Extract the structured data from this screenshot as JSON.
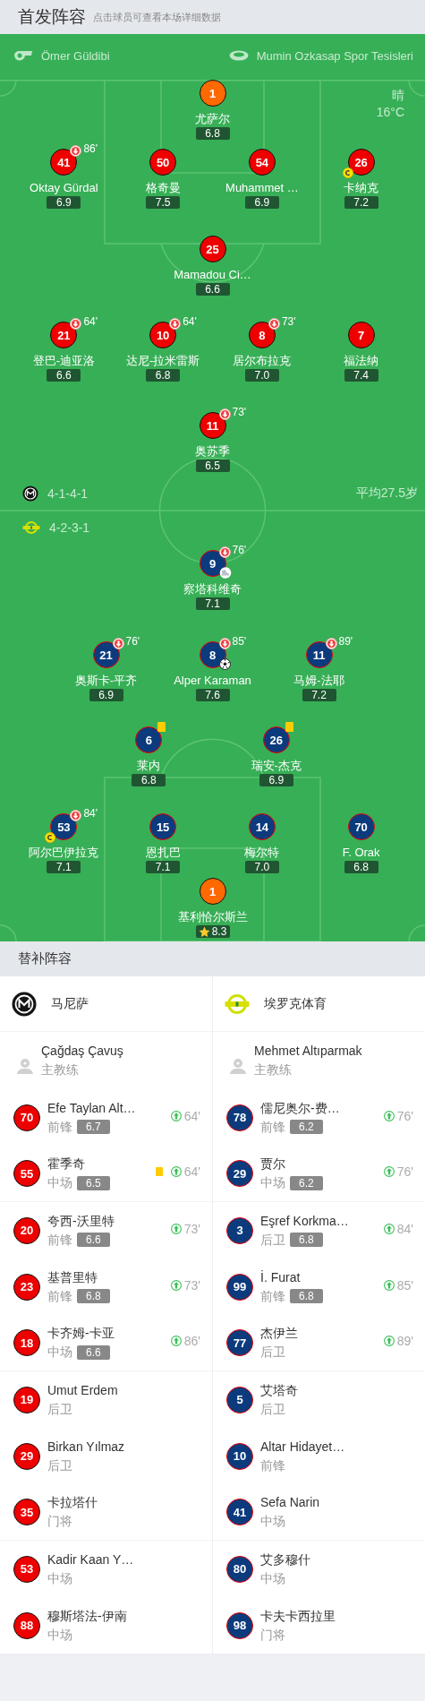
{
  "header": {
    "title": "首发阵容",
    "hint": "点击球员可查看本场详细数据"
  },
  "match_info": {
    "referee": "Ömer Güldibi",
    "stadium": "Mumin Ozkasap Spor Tesisleri",
    "weather": "晴",
    "temperature": "16°C"
  },
  "teams": [
    {
      "color": "#ee0000",
      "name": "马尼萨",
      "formation": "4-1-4-1",
      "average_age": "平均27.5岁",
      "lines": [
        {
          "players": [
            {
              "number": "1",
              "name": "尤萨尔",
              "rating": "6.8",
              "kind": "goalkeeper",
              "captain": false,
              "yellow_card": false,
              "mvp": false
            }
          ]
        },
        {
          "players": [
            {
              "number": "41",
              "name": "Oktay Gürdal",
              "rating": "6.9",
              "kind": "outfield",
              "captain": false,
              "yellow_card": false,
              "mvp": false,
              "sub_off": "86'"
            },
            {
              "number": "50",
              "name": "格奇曼",
              "rating": "7.5",
              "kind": "outfield",
              "captain": false,
              "yellow_card": false,
              "mvp": false
            },
            {
              "number": "54",
              "name": "Muhammet …",
              "rating": "6.9",
              "kind": "outfield",
              "captain": false,
              "yellow_card": false,
              "mvp": false
            },
            {
              "number": "26",
              "name": "卡纳克",
              "rating": "7.2",
              "kind": "outfield",
              "captain": true,
              "yellow_card": false,
              "mvp": false
            }
          ]
        },
        {
          "players": [
            {
              "number": "25",
              "name": "Mamadou Ci…",
              "rating": "6.6",
              "kind": "outfield",
              "captain": false,
              "yellow_card": false,
              "mvp": false
            }
          ]
        },
        {
          "players": [
            {
              "number": "21",
              "name": "登巴-迪亚洛",
              "rating": "6.6",
              "kind": "outfield",
              "captain": false,
              "yellow_card": false,
              "mvp": false,
              "sub_off": "64'"
            },
            {
              "number": "10",
              "name": "达尼-拉米雷斯",
              "rating": "6.8",
              "kind": "outfield",
              "captain": false,
              "yellow_card": false,
              "mvp": false,
              "sub_off": "64'"
            },
            {
              "number": "8",
              "name": "居尔布拉克",
              "rating": "7.0",
              "kind": "outfield",
              "captain": false,
              "yellow_card": false,
              "mvp": false,
              "sub_off": "73'"
            },
            {
              "number": "7",
              "name": "福法纳",
              "rating": "7.4",
              "kind": "outfield",
              "captain": false,
              "yellow_card": false,
              "mvp": false
            }
          ]
        },
        {
          "players": [
            {
              "number": "11",
              "name": "奥苏季",
              "rating": "6.5",
              "kind": "outfield",
              "captain": false,
              "yellow_card": false,
              "mvp": false,
              "sub_off": "73'"
            }
          ]
        }
      ],
      "coach": {
        "name": "Çağdaş Çavuş",
        "role": "主教练"
      },
      "substitutes": [
        {
          "number": "70",
          "name": "Efe Taylan Alt…",
          "position": "前锋",
          "rating": "6.7",
          "sub_on": "64'",
          "yellow_card": false
        },
        {
          "number": "55",
          "name": "霍季奇",
          "position": "中场",
          "rating": "6.5",
          "sub_on": "64'",
          "yellow_card": true
        },
        {
          "number": "20",
          "name": "夸西-沃里特",
          "position": "前锋",
          "rating": "6.6",
          "sub_on": "73'",
          "yellow_card": false
        },
        {
          "number": "23",
          "name": "基普里特",
          "position": "前锋",
          "rating": "6.8",
          "sub_on": "73'",
          "yellow_card": false
        },
        {
          "number": "18",
          "name": "卡齐姆-卡亚",
          "position": "中场",
          "rating": "6.6",
          "sub_on": "86'",
          "yellow_card": false
        },
        {
          "number": "19",
          "name": "Umut Erdem",
          "position": "后卫",
          "yellow_card": false
        },
        {
          "number": "29",
          "name": "Birkan Yılmaz",
          "position": "后卫",
          "yellow_card": false
        },
        {
          "number": "35",
          "name": "卡拉塔什",
          "position": "门将",
          "yellow_card": false
        },
        {
          "number": "53",
          "name": "Kadir Kaan Y…",
          "position": "中场",
          "yellow_card": false
        },
        {
          "number": "88",
          "name": "穆斯塔法-伊南",
          "position": "中场",
          "yellow_card": false
        }
      ]
    },
    {
      "color": "#0c3b7d",
      "name": "埃罗克体育",
      "formation": "4-2-3-1",
      "lines": [
        {
          "players": [
            {
              "number": "9",
              "name": "察塔科维奇",
              "rating": "7.1",
              "kind": "outfield",
              "captain": false,
              "yellow_card": false,
              "mvp": false,
              "sub_off": "76'",
              "goal": false,
              "assist": true
            }
          ]
        },
        {
          "players": [
            {
              "number": "21",
              "name": "奥斯卡-平齐",
              "rating": "6.9",
              "kind": "outfield",
              "captain": false,
              "yellow_card": false,
              "mvp": false,
              "sub_off": "76'"
            },
            {
              "number": "8",
              "name": "Alper Karaman",
              "rating": "7.6",
              "kind": "outfield",
              "captain": false,
              "yellow_card": false,
              "mvp": false,
              "sub_off": "85'",
              "goal": true,
              "assist": false
            },
            {
              "number": "11",
              "name": "马姆-法耶",
              "rating": "7.2",
              "kind": "outfield",
              "captain": false,
              "yellow_card": false,
              "mvp": false,
              "sub_off": "89'"
            }
          ]
        },
        {
          "players": [
            {
              "number": "6",
              "name": "莱内",
              "rating": "6.8",
              "kind": "outfield",
              "captain": false,
              "yellow_card": true,
              "mvp": false
            },
            {
              "number": "26",
              "name": "瑞安-杰克",
              "rating": "6.9",
              "kind": "outfield",
              "captain": false,
              "yellow_card": true,
              "mvp": false
            }
          ]
        },
        {
          "players": [
            {
              "number": "53",
              "name": "阿尔巴伊拉克",
              "rating": "7.1",
              "kind": "outfield",
              "captain": true,
              "yellow_card": false,
              "mvp": false,
              "sub_off": "84'"
            },
            {
              "number": "15",
              "name": "恩扎巴",
              "rating": "7.1",
              "kind": "outfield",
              "captain": false,
              "yellow_card": false,
              "mvp": false
            },
            {
              "number": "14",
              "name": "梅尔特",
              "rating": "7.0",
              "kind": "outfield",
              "captain": false,
              "yellow_card": false,
              "mvp": false
            },
            {
              "number": "70",
              "name": "F. Orak",
              "rating": "6.8",
              "kind": "outfield",
              "captain": false,
              "yellow_card": false,
              "mvp": false
            }
          ]
        },
        {
          "players": [
            {
              "number": "1",
              "name": "基利恰尔斯兰",
              "rating": "8.3",
              "kind": "goalkeeper",
              "captain": false,
              "yellow_card": false,
              "mvp": true
            }
          ]
        }
      ],
      "coach": {
        "name": "Mehmet Altıparmak",
        "role": "主教练"
      },
      "substitutes": [
        {
          "number": "78",
          "name": "儒尼奥尔-费…",
          "position": "前锋",
          "rating": "6.2",
          "sub_on": "76'",
          "yellow_card": false
        },
        {
          "number": "29",
          "name": "贾尔",
          "position": "中场",
          "rating": "6.2",
          "sub_on": "76'",
          "yellow_card": false
        },
        {
          "number": "3",
          "name": "Eşref Korkma…",
          "position": "后卫",
          "rating": "6.8",
          "sub_on": "84'",
          "yellow_card": false
        },
        {
          "number": "99",
          "name": "İ. Furat",
          "position": "前锋",
          "rating": "6.8",
          "sub_on": "85'",
          "yellow_card": false
        },
        {
          "number": "77",
          "name": "杰伊兰",
          "position": "后卫",
          "sub_on": "89'",
          "yellow_card": false
        },
        {
          "number": "5",
          "name": "艾塔奇",
          "position": "后卫",
          "yellow_card": false
        },
        {
          "number": "10",
          "name": "Altar Hidayet…",
          "position": "前锋",
          "yellow_card": false
        },
        {
          "number": "41",
          "name": "Sefa Narin",
          "position": "中场",
          "yellow_card": false
        },
        {
          "number": "80",
          "name": "艾多穆什",
          "position": "中场",
          "yellow_card": false
        },
        {
          "number": "98",
          "name": "卡夫卡西拉里",
          "position": "门将",
          "yellow_card": false
        }
      ]
    }
  ],
  "substitutes_title": "替补阵容"
}
